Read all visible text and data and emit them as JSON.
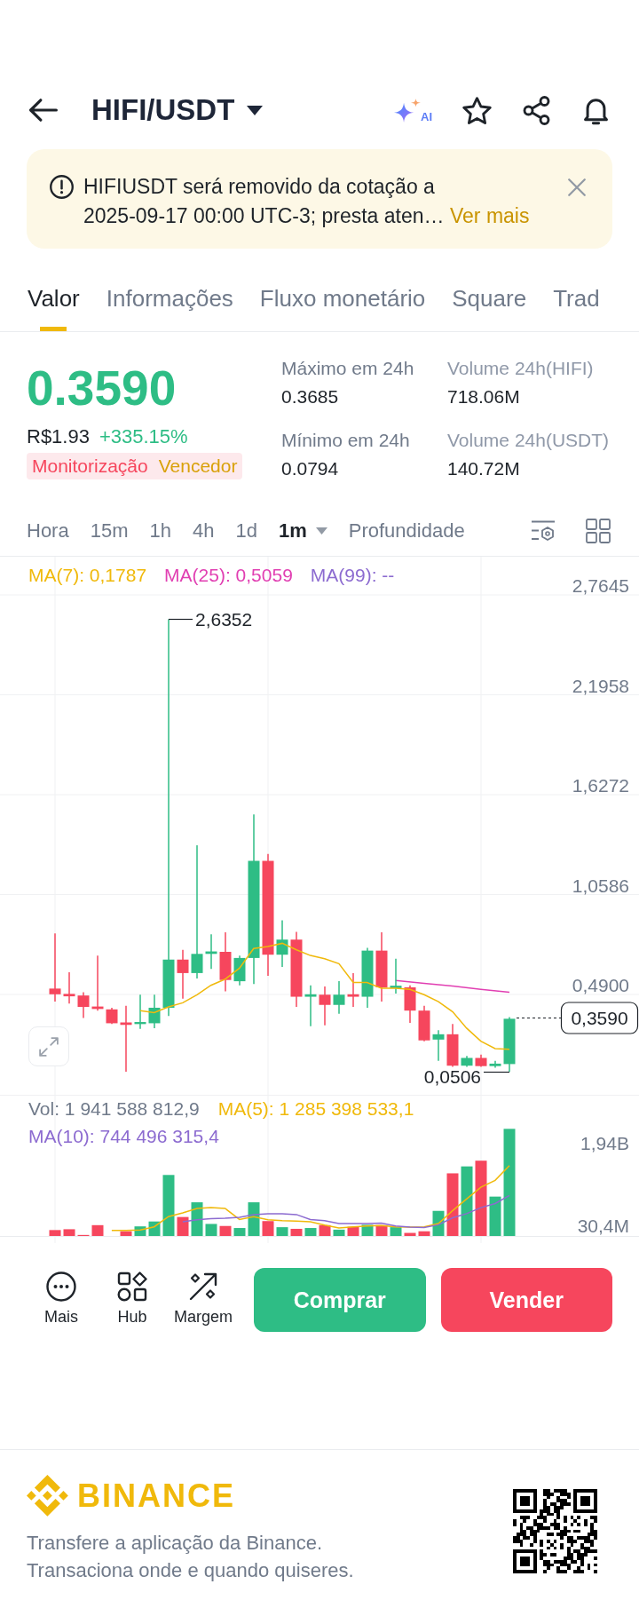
{
  "header": {
    "title": "HIFI/USDT",
    "ai_badge": "AI"
  },
  "notice": {
    "message": "HIFIUSDT será removido da cotação a\n2025-09-17 00:00 UTC-3; presta aten…",
    "link": "Ver mais"
  },
  "tabs": [
    {
      "label": "Valor",
      "selected": true
    },
    {
      "label": "Informações",
      "selected": false
    },
    {
      "label": "Fluxo monetário",
      "selected": false
    },
    {
      "label": "Square",
      "selected": false
    },
    {
      "label": "Trad",
      "selected": false
    }
  ],
  "ticker": {
    "price": "0.3590",
    "price_local": "R$1.93",
    "change": "+335.15%",
    "tags": [
      {
        "label": "Monitorização",
        "color": "#f6465d"
      },
      {
        "label": "Vencedor",
        "color": "#d9a10a"
      }
    ]
  },
  "stats": [
    {
      "label": "Máximo em 24h",
      "value": "0.3685"
    },
    {
      "label": "Volume 24h(HIFI)",
      "value": "718.06M"
    },
    {
      "label": "Mínimo em 24h",
      "value": "0.0794"
    },
    {
      "label": "Volume 24h(USDT)",
      "value": "140.72M"
    }
  ],
  "intervals": [
    {
      "label": "Hora",
      "selected": false,
      "menu": false
    },
    {
      "label": "15m",
      "selected": false,
      "menu": false
    },
    {
      "label": "1h",
      "selected": false,
      "menu": false
    },
    {
      "label": "4h",
      "selected": false,
      "menu": false
    },
    {
      "label": "1d",
      "selected": false,
      "menu": false
    },
    {
      "label": "1m",
      "selected": true,
      "menu": true
    },
    {
      "label": "Profundidade",
      "selected": false,
      "menu": false
    }
  ],
  "chart": {
    "legend": [
      {
        "label": "MA(7): 0,1787",
        "color": "#f0b90b"
      },
      {
        "label": "MA(25): 0,5059",
        "color": "#e13fb2"
      },
      {
        "label": "MA(99): --",
        "color": "#8c6bd0"
      }
    ],
    "price_axis": [
      "2,7645",
      "2,1958",
      "1,6272",
      "1,0586",
      "0,4900"
    ],
    "high_label": "2,6352",
    "low_label": "0,0506",
    "last_price": "0,3590"
  },
  "volume": {
    "legend": [
      {
        "label": "Vol: 1 941 588 812,9",
        "color": "#707a8a"
      },
      {
        "label": "MA(5): 1 285 398 533,1",
        "color": "#f0b90b"
      },
      {
        "label": "MA(10): 744 496 315,4",
        "color": "#8c6bd0"
      }
    ],
    "axis": [
      "1,94B",
      "30,4M"
    ]
  },
  "actions": [
    {
      "label": "Mais"
    },
    {
      "label": "Hub"
    },
    {
      "label": "Margem"
    }
  ],
  "trade_buttons": [
    {
      "label": "Comprar",
      "kind": "buy"
    },
    {
      "label": "Vender",
      "kind": "sell"
    }
  ],
  "footer": {
    "brand": "BINANCE",
    "lines": [
      "Transfere a aplicação da Binance.",
      "Transaciona onde e quando quiseres."
    ]
  }
}
